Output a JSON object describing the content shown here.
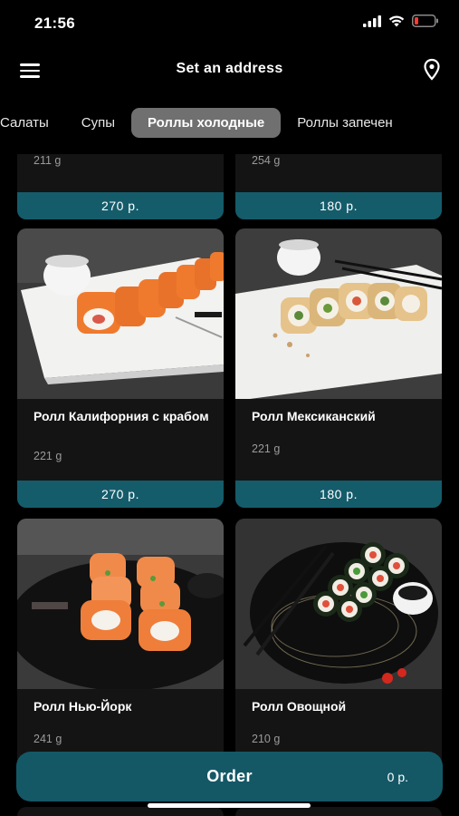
{
  "status": {
    "time": "21:56",
    "icons": [
      "signal-icon",
      "wifi-icon",
      "battery-icon"
    ]
  },
  "header": {
    "title": "Set an address",
    "menu_icon": "hamburger-icon",
    "location_icon": "map-pin-icon"
  },
  "tabs": [
    {
      "label": "Салаты",
      "active": false
    },
    {
      "label": "Супы",
      "active": false
    },
    {
      "label": "Роллы холодные",
      "active": true
    },
    {
      "label": "Роллы запечен",
      "active": false
    }
  ],
  "products": [
    {
      "name": "",
      "weight": "211 g",
      "price": "270 р."
    },
    {
      "name": "",
      "weight": "254 g",
      "price": "180 р."
    },
    {
      "name": "Ролл Калифорния с крабом",
      "weight": "221 g",
      "price": "270 р."
    },
    {
      "name": "Ролл Мексиканский",
      "weight": "221 g",
      "price": "180 р."
    },
    {
      "name": "Ролл Нью-Йорк",
      "weight": "241 g",
      "price": ""
    },
    {
      "name": "Ролл Овощной",
      "weight": "210 g",
      "price": ""
    }
  ],
  "order": {
    "label": "Order",
    "total": "0 р."
  },
  "colors": {
    "background": "#000000",
    "card": "#141414",
    "accent": "#155c6b",
    "tab_active": "#707070"
  }
}
